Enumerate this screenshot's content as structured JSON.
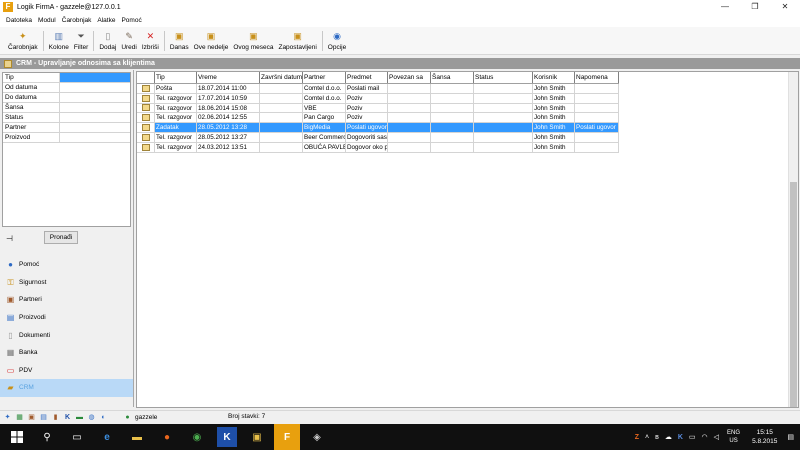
{
  "window": {
    "title": "Logik FirmA - gazzele@127.0.0.1",
    "app_icon": "F",
    "controls": [
      "—",
      "❐",
      "✕"
    ]
  },
  "menu": [
    "Datoteka",
    "Modul",
    "Čarobnjak",
    "Alatke",
    "Pomoć"
  ],
  "toolbar": {
    "buttons": [
      {
        "label": "Čarobnjak",
        "icon": "wand-icon"
      },
      {
        "label": "Kolone",
        "icon": "columns-icon"
      },
      {
        "label": "Filter",
        "icon": "filter-icon"
      },
      {
        "label": "Dodaj",
        "icon": "add-icon"
      },
      {
        "label": "Uredi",
        "icon": "edit-icon"
      },
      {
        "label": "Izbriši",
        "icon": "delete-icon"
      },
      {
        "label": "Danas",
        "icon": "today-icon"
      },
      {
        "label": "Ove nedelje",
        "icon": "week-icon"
      },
      {
        "label": "Ovog meseca",
        "icon": "month-icon"
      },
      {
        "label": "Zapostavljeni",
        "icon": "neglected-icon"
      },
      {
        "label": "Opcije",
        "icon": "options-icon"
      }
    ]
  },
  "section": {
    "title": "CRM - Upravljanje odnosima sa klijentima"
  },
  "filters": {
    "fields": [
      "Tip",
      "Od datuma",
      "Do datuma",
      "Šansa",
      "Status",
      "Partner",
      "Proizvod"
    ],
    "search_label": "Pronađi"
  },
  "nav": {
    "items": [
      {
        "label": "Pomoć",
        "icon": "help-icon"
      },
      {
        "label": "Sigurnost",
        "icon": "key-icon"
      },
      {
        "label": "Partneri",
        "icon": "partners-icon"
      },
      {
        "label": "Proizvodi",
        "icon": "products-icon"
      },
      {
        "label": "Dokumenti",
        "icon": "documents-icon"
      },
      {
        "label": "Banka",
        "icon": "bank-icon"
      },
      {
        "label": "PDV",
        "icon": "vat-icon"
      },
      {
        "label": "CRM",
        "icon": "crm-icon"
      }
    ],
    "active_index": 7
  },
  "grid": {
    "columns": [
      "Tip",
      "Vreme",
      "Završni datum",
      "Partner",
      "Predmet",
      "Povezan sa",
      "Šansa",
      "Status",
      "Korisnik",
      "Napomena"
    ],
    "rows": [
      [
        "Pošta",
        "18.07.2014 11:00",
        "",
        "Comtel d.o.o.",
        "Poslati mail",
        "",
        "",
        "",
        "John Smith",
        ""
      ],
      [
        "Tel. razgovor",
        "17.07.2014 10:59",
        "",
        "Comtel d.o.o.",
        "Poziv",
        "",
        "",
        "",
        "John Smith",
        ""
      ],
      [
        "Tel. razgovor",
        "18.06.2014 15:08",
        "",
        "VBE",
        "Poziv",
        "",
        "",
        "",
        "John Smith",
        ""
      ],
      [
        "Tel. razgovor",
        "02.06.2014 12:55",
        "",
        "Pan Cargo",
        "Poziv",
        "",
        "",
        "",
        "John Smith",
        ""
      ],
      [
        "Zadatak",
        "28.05.2012 13:28",
        "",
        "BigMedia",
        "Poslati ugovor",
        "",
        "",
        "",
        "John Smith",
        "Poslati ugovor"
      ],
      [
        "Tel. razgovor",
        "28.05.2012 13:27",
        "",
        "Beer Commerce",
        "Dogovoriti sast",
        "",
        "",
        "",
        "John Smith",
        ""
      ],
      [
        "Tel. razgovor",
        "24.03.2012 13:51",
        "",
        "OBUĆA PAVLE",
        "Dogovor oko p",
        "",
        "",
        "",
        "John Smith",
        ""
      ]
    ],
    "selected_index": 4
  },
  "status": {
    "user": "gazzele",
    "count_text": "Broj stavki: 7"
  },
  "taskbar": {
    "lang": "ENG",
    "region": "US",
    "time": "15:15",
    "date": "5.8.2015"
  }
}
